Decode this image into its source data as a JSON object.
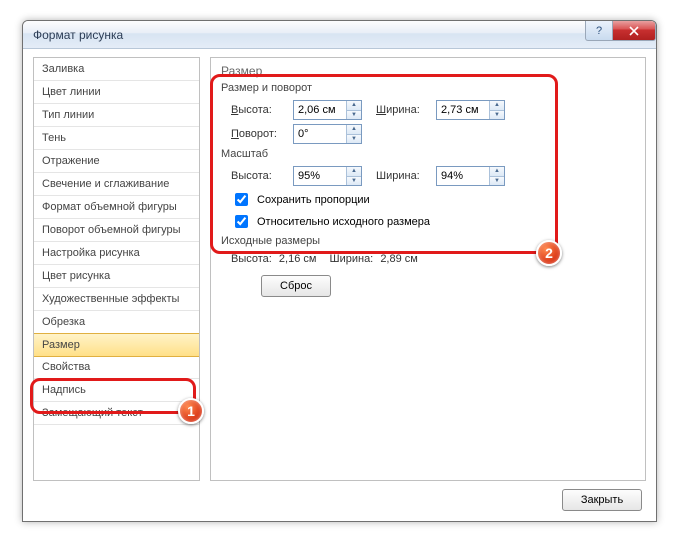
{
  "title": "Формат рисунка",
  "sidebar": {
    "items": [
      "Заливка",
      "Цвет линии",
      "Тип линии",
      "Тень",
      "Отражение",
      "Свечение и сглаживание",
      "Формат объемной фигуры",
      "Поворот объемной фигуры",
      "Настройка рисунка",
      "Цвет рисунка",
      "Художественные эффекты",
      "Обрезка",
      "Размер",
      "Свойства",
      "Надпись",
      "Замещающий текст"
    ],
    "selected_index": 12
  },
  "panel": {
    "header": "Размер",
    "group_size_rotate": "Размер и поворот",
    "height_label": "Высота:",
    "height_value": "2,06 см",
    "width_label": "Ширина:",
    "width_value": "2,73 см",
    "rotate_label": "Поворот:",
    "rotate_value": "0°",
    "group_scale": "Масштаб",
    "scale_h_label": "Высота:",
    "scale_h_value": "95%",
    "scale_w_label": "Ширина:",
    "scale_w_value": "94%",
    "lock_aspect": "Сохранить пропорции",
    "relative_orig": "Относительно исходного размера",
    "group_orig": "Исходные размеры",
    "orig_h_label": "Высота:",
    "orig_h_value": "2,16 см",
    "orig_w_label": "Ширина:",
    "orig_w_value": "2,89 см",
    "reset": "Сброс"
  },
  "footer": {
    "close": "Закрыть"
  },
  "annotations": {
    "n1": "1",
    "n2": "2"
  }
}
